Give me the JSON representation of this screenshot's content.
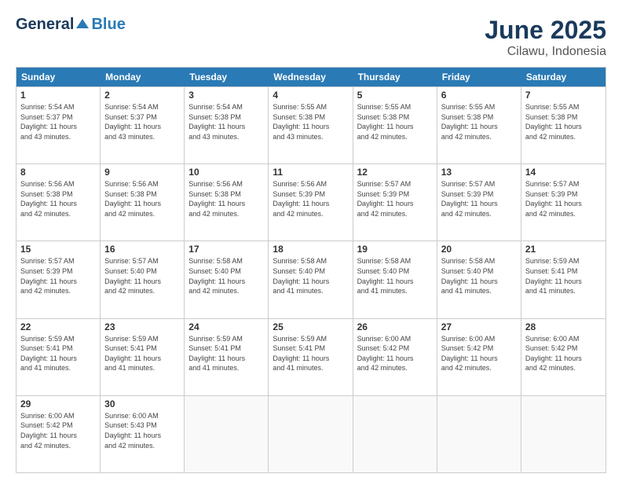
{
  "header": {
    "logo_general": "General",
    "logo_blue": "Blue",
    "title": "June 2025",
    "subtitle": "Cilawu, Indonesia"
  },
  "calendar": {
    "days_of_week": [
      "Sunday",
      "Monday",
      "Tuesday",
      "Wednesday",
      "Thursday",
      "Friday",
      "Saturday"
    ],
    "rows": [
      [
        {
          "day": 1,
          "info": "Sunrise: 5:54 AM\nSunset: 5:37 PM\nDaylight: 11 hours\nand 43 minutes."
        },
        {
          "day": 2,
          "info": "Sunrise: 5:54 AM\nSunset: 5:37 PM\nDaylight: 11 hours\nand 43 minutes."
        },
        {
          "day": 3,
          "info": "Sunrise: 5:54 AM\nSunset: 5:38 PM\nDaylight: 11 hours\nand 43 minutes."
        },
        {
          "day": 4,
          "info": "Sunrise: 5:55 AM\nSunset: 5:38 PM\nDaylight: 11 hours\nand 43 minutes."
        },
        {
          "day": 5,
          "info": "Sunrise: 5:55 AM\nSunset: 5:38 PM\nDaylight: 11 hours\nand 42 minutes."
        },
        {
          "day": 6,
          "info": "Sunrise: 5:55 AM\nSunset: 5:38 PM\nDaylight: 11 hours\nand 42 minutes."
        },
        {
          "day": 7,
          "info": "Sunrise: 5:55 AM\nSunset: 5:38 PM\nDaylight: 11 hours\nand 42 minutes."
        }
      ],
      [
        {
          "day": 8,
          "info": "Sunrise: 5:56 AM\nSunset: 5:38 PM\nDaylight: 11 hours\nand 42 minutes."
        },
        {
          "day": 9,
          "info": "Sunrise: 5:56 AM\nSunset: 5:38 PM\nDaylight: 11 hours\nand 42 minutes."
        },
        {
          "day": 10,
          "info": "Sunrise: 5:56 AM\nSunset: 5:38 PM\nDaylight: 11 hours\nand 42 minutes."
        },
        {
          "day": 11,
          "info": "Sunrise: 5:56 AM\nSunset: 5:39 PM\nDaylight: 11 hours\nand 42 minutes."
        },
        {
          "day": 12,
          "info": "Sunrise: 5:57 AM\nSunset: 5:39 PM\nDaylight: 11 hours\nand 42 minutes."
        },
        {
          "day": 13,
          "info": "Sunrise: 5:57 AM\nSunset: 5:39 PM\nDaylight: 11 hours\nand 42 minutes."
        },
        {
          "day": 14,
          "info": "Sunrise: 5:57 AM\nSunset: 5:39 PM\nDaylight: 11 hours\nand 42 minutes."
        }
      ],
      [
        {
          "day": 15,
          "info": "Sunrise: 5:57 AM\nSunset: 5:39 PM\nDaylight: 11 hours\nand 42 minutes."
        },
        {
          "day": 16,
          "info": "Sunrise: 5:57 AM\nSunset: 5:40 PM\nDaylight: 11 hours\nand 42 minutes."
        },
        {
          "day": 17,
          "info": "Sunrise: 5:58 AM\nSunset: 5:40 PM\nDaylight: 11 hours\nand 42 minutes."
        },
        {
          "day": 18,
          "info": "Sunrise: 5:58 AM\nSunset: 5:40 PM\nDaylight: 11 hours\nand 41 minutes."
        },
        {
          "day": 19,
          "info": "Sunrise: 5:58 AM\nSunset: 5:40 PM\nDaylight: 11 hours\nand 41 minutes."
        },
        {
          "day": 20,
          "info": "Sunrise: 5:58 AM\nSunset: 5:40 PM\nDaylight: 11 hours\nand 41 minutes."
        },
        {
          "day": 21,
          "info": "Sunrise: 5:59 AM\nSunset: 5:41 PM\nDaylight: 11 hours\nand 41 minutes."
        }
      ],
      [
        {
          "day": 22,
          "info": "Sunrise: 5:59 AM\nSunset: 5:41 PM\nDaylight: 11 hours\nand 41 minutes."
        },
        {
          "day": 23,
          "info": "Sunrise: 5:59 AM\nSunset: 5:41 PM\nDaylight: 11 hours\nand 41 minutes."
        },
        {
          "day": 24,
          "info": "Sunrise: 5:59 AM\nSunset: 5:41 PM\nDaylight: 11 hours\nand 41 minutes."
        },
        {
          "day": 25,
          "info": "Sunrise: 5:59 AM\nSunset: 5:41 PM\nDaylight: 11 hours\nand 41 minutes."
        },
        {
          "day": 26,
          "info": "Sunrise: 6:00 AM\nSunset: 5:42 PM\nDaylight: 11 hours\nand 42 minutes."
        },
        {
          "day": 27,
          "info": "Sunrise: 6:00 AM\nSunset: 5:42 PM\nDaylight: 11 hours\nand 42 minutes."
        },
        {
          "day": 28,
          "info": "Sunrise: 6:00 AM\nSunset: 5:42 PM\nDaylight: 11 hours\nand 42 minutes."
        }
      ],
      [
        {
          "day": 29,
          "info": "Sunrise: 6:00 AM\nSunset: 5:42 PM\nDaylight: 11 hours\nand 42 minutes."
        },
        {
          "day": 30,
          "info": "Sunrise: 6:00 AM\nSunset: 5:43 PM\nDaylight: 11 hours\nand 42 minutes."
        },
        {
          "day": null,
          "info": ""
        },
        {
          "day": null,
          "info": ""
        },
        {
          "day": null,
          "info": ""
        },
        {
          "day": null,
          "info": ""
        },
        {
          "day": null,
          "info": ""
        }
      ]
    ]
  }
}
